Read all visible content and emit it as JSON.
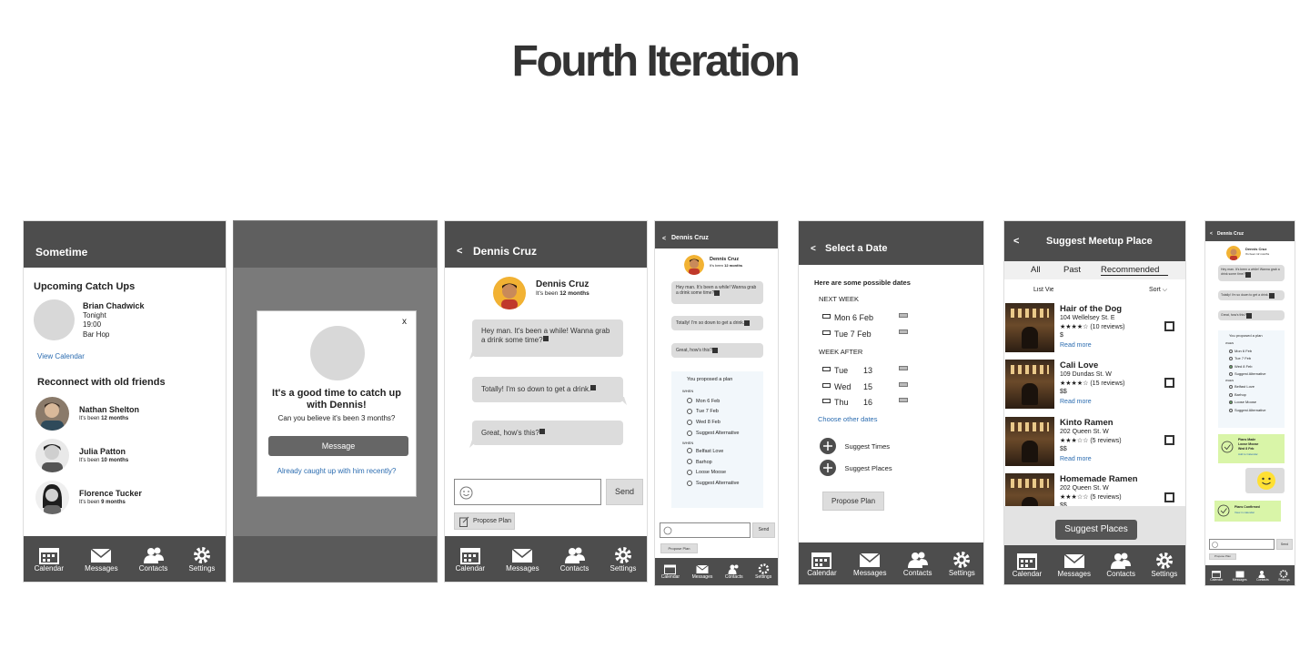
{
  "title": "Fourth Iteration",
  "tabs": [
    "Calendar",
    "Messages",
    "Contacts",
    "Settings"
  ],
  "screen1": {
    "header": "Sometime",
    "upcoming_heading": "Upcoming Catch Ups",
    "catchup": {
      "name": "Brian Chadwick",
      "when": "Tonight",
      "time": "19:00",
      "place": "Bar Hop"
    },
    "view_calendar": "View Calendar",
    "reconnect_heading": "Reconnect with old friends",
    "friends": [
      {
        "name": "Nathan Shelton",
        "since_prefix": "It's been ",
        "since": "12 months"
      },
      {
        "name": "Julia Patton",
        "since_prefix": "It's been ",
        "since": "10 months"
      },
      {
        "name": "Florence Tucker",
        "since_prefix": "It's been ",
        "since": "9 months"
      }
    ]
  },
  "screen2": {
    "close": "x",
    "headline": "It's a good time to catch up with Dennis!",
    "sub": "Can you believe it's been 3 months?",
    "message_btn": "Message",
    "already_link": "Already caught up with him recently?"
  },
  "screen3": {
    "back": "<",
    "header": "Dennis Cruz",
    "name": "Dennis Cruz",
    "since_prefix": "It's been ",
    "since": "12 months",
    "messages": [
      "Hey man. It's been a while! Wanna grab a drink some time?",
      "Totally! I'm so down to get a drink.",
      "Great, how's this?"
    ],
    "send": "Send",
    "propose": "Propose Plan"
  },
  "screen4": {
    "back": "<",
    "header": "Dennis Cruz",
    "name": "Dennis Cruz",
    "since_prefix": "It's been ",
    "since": "12 months",
    "messages": [
      "Hey man. It's been a while! Wanna grab a drink some time?",
      "Totally! I'm so down to get a drink.",
      "Great, how's this?"
    ],
    "plan_title": "You proposed a plan",
    "when_label": "WHEN",
    "dates": [
      "Mon 6 Feb",
      "Tue   7 Feb",
      "Wed 8 Feb",
      "Suggest Alternative"
    ],
    "where_label": "WHEN",
    "places": [
      "Belfast Love",
      "Barhop",
      "Loose Moose",
      "Suggest Alternative"
    ],
    "send": "Send",
    "propose": "Propose Plan"
  },
  "screen5": {
    "back": "<",
    "header": "Select a Date",
    "intro": "Here are some possible dates",
    "next_week": "NEXT WEEK",
    "next_dates": [
      "Mon  6 Feb",
      "Tue  7 Feb"
    ],
    "week_after": "WEEK AFTER",
    "after_dates": [
      {
        "day": "Tue",
        "num": "13"
      },
      {
        "day": "Wed",
        "num": "15"
      },
      {
        "day": "Thu",
        "num": "16"
      }
    ],
    "choose_other": "Choose other dates",
    "suggest_times": "Suggest Times",
    "suggest_places": "Suggest Places",
    "propose": "Propose Plan"
  },
  "screen6": {
    "back": "<",
    "header": "Suggest Meetup Place",
    "filters": [
      "All",
      "Past",
      "Recommended"
    ],
    "list_view": "List Vie",
    "sort": "Sort",
    "places": [
      {
        "name": "Hair of the Dog",
        "addr": "104 Wellelsey St. E",
        "stars": "★★★★☆",
        "reviews": "(10 reviews)",
        "price": "$",
        "more": "Read more"
      },
      {
        "name": "Cali Love",
        "addr": "109 Dundas St. W",
        "stars": "★★★★☆",
        "reviews": "(15 reviews)",
        "price": "$$",
        "more": "Read more"
      },
      {
        "name": "Kinto Ramen",
        "addr": "202 Queen St. W",
        "stars": "★★★☆☆",
        "reviews": "(5 reviews)",
        "price": "$$",
        "more": "Read more"
      },
      {
        "name": "Homemade Ramen",
        "addr": "202 Queen St. W",
        "stars": "★★★☆☆",
        "reviews": "(5 reviews)",
        "price": "$$",
        "more": ""
      }
    ],
    "suggest_btn": "Suggest Places"
  },
  "screen7": {
    "back": "<",
    "header": "Dennis Cruz",
    "name": "Dennis Cruz",
    "since": "It's been 12 months",
    "messages": [
      "Hey man. It's been a while! Wanna grab a drink some time?",
      "Totally! I'm so down to get a drink.",
      "Great, how's this?"
    ],
    "plan_title": "You proposed a plan",
    "when_label": "WHEN",
    "dates": [
      "Mon 6 Feb",
      "Tue  7 Feb",
      "Wed 8 Feb",
      "Suggest Alternative"
    ],
    "where_label": "WHEN",
    "places": [
      "Belfast Love",
      "Barhop",
      "Loose Moose",
      "Suggest Alternative"
    ],
    "plans_made": "Plans Made",
    "plans_made_place": "Loose Moose",
    "plans_made_date": "Wed 8 Feb",
    "add_cal": "Add to Calendar",
    "plans_confirmed": "Plans Confirmed",
    "view_cal": "View in calendar",
    "send": "Send",
    "propose": "Propose Plan"
  }
}
